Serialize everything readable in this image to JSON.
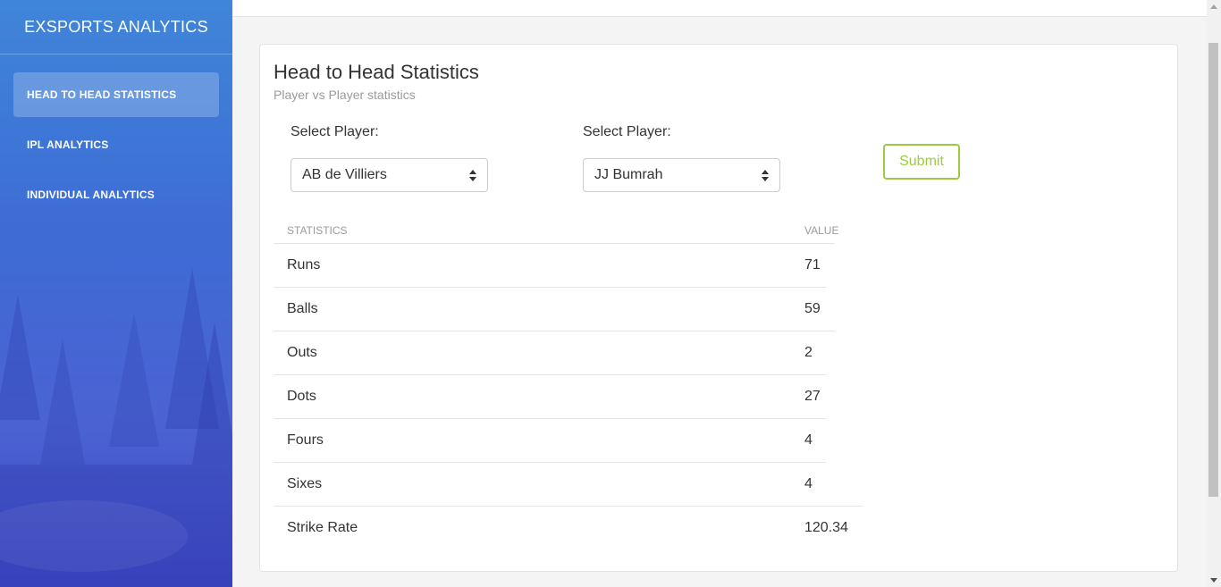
{
  "sidebar": {
    "brand": "EXSPORTS ANALYTICS",
    "items": [
      {
        "label": "HEAD TO HEAD STATISTICS",
        "active": true
      },
      {
        "label": "IPL ANALYTICS",
        "active": false
      },
      {
        "label": "INDIVIDUAL ANALYTICS",
        "active": false
      }
    ]
  },
  "card": {
    "title": "Head to Head Statistics",
    "subtitle": "Player vs Player statistics"
  },
  "form": {
    "player1_label": "Select Player:",
    "player1_value": "AB de Villiers",
    "player2_label": "Select Player:",
    "player2_value": "JJ Bumrah",
    "submit_label": "Submit"
  },
  "table": {
    "headers": [
      "STATISTICS",
      "VALUE"
    ],
    "rows": [
      {
        "stat": "Runs",
        "value": "71"
      },
      {
        "stat": "Balls",
        "value": "59"
      },
      {
        "stat": "Outs",
        "value": "2"
      },
      {
        "stat": "Dots",
        "value": "27"
      },
      {
        "stat": "Fours",
        "value": "4"
      },
      {
        "stat": "Sixes",
        "value": "4"
      },
      {
        "stat": "Strike Rate",
        "value": "120.34"
      }
    ]
  },
  "colors": {
    "sidebar_top": "#3f86d9",
    "sidebar_bottom": "#3a43c4",
    "submit_accent": "#9ccc3d"
  }
}
